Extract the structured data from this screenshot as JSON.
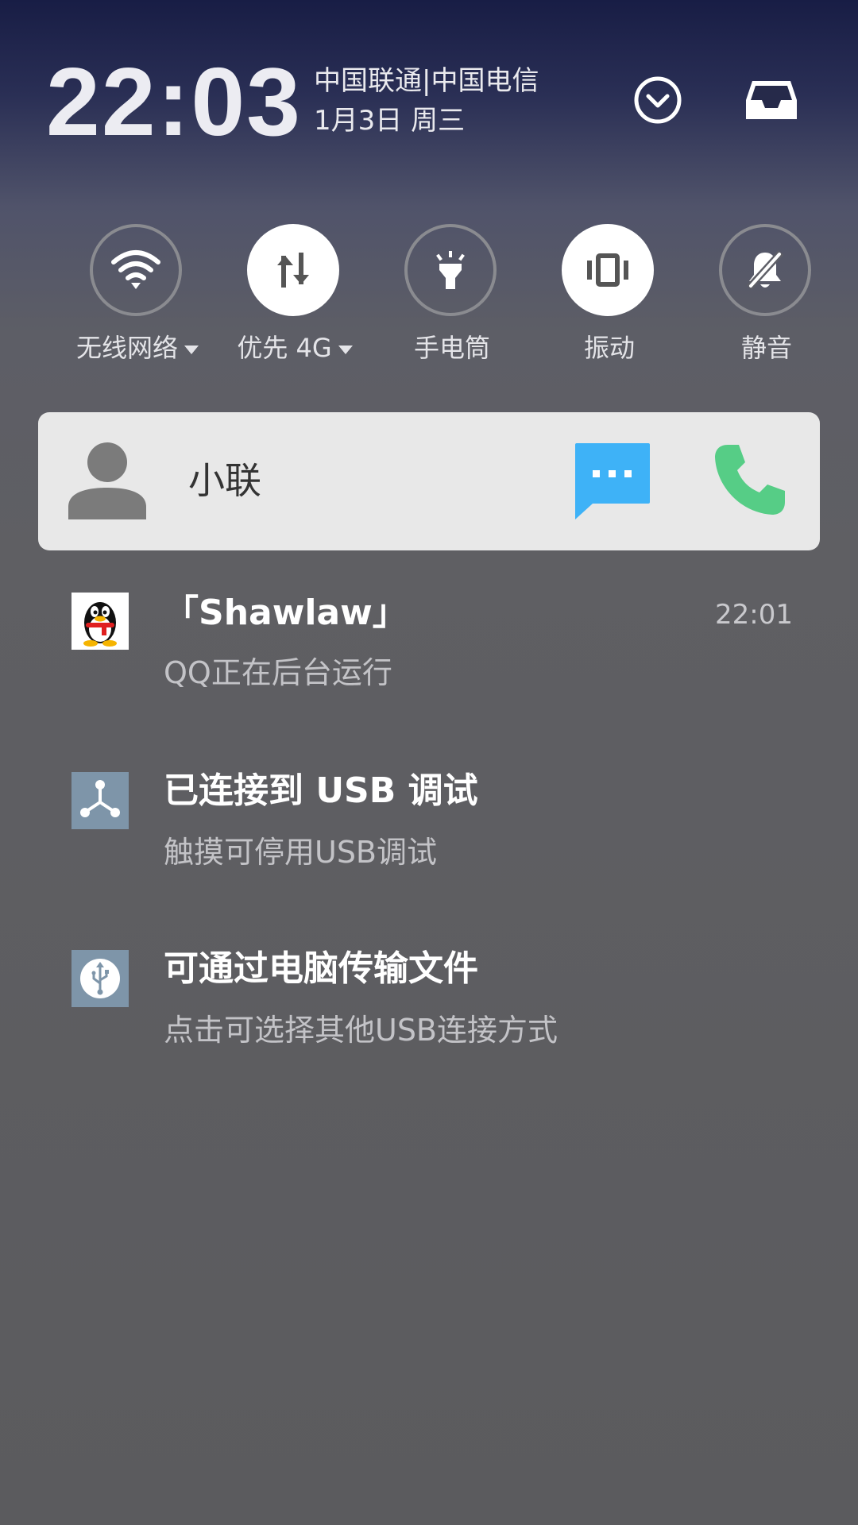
{
  "header": {
    "time": "22:03",
    "carrier": "中国联通|中国电信",
    "date": "1月3日 周三",
    "expand_icon": "chevron-down-circle-icon",
    "inbox_icon": "inbox-tray-icon"
  },
  "toggles": [
    {
      "label": "无线网络",
      "icon": "wifi-icon",
      "active": false,
      "has_dropdown": true
    },
    {
      "label": "优先 4G",
      "icon": "mobile-data-icon",
      "active": true,
      "has_dropdown": true
    },
    {
      "label": "手电筒",
      "icon": "flashlight-icon",
      "active": false,
      "has_dropdown": false
    },
    {
      "label": "振动",
      "icon": "vibrate-icon",
      "active": true,
      "has_dropdown": false
    },
    {
      "label": "静音",
      "icon": "bell-off-icon",
      "active": false,
      "has_dropdown": false
    }
  ],
  "contact_card": {
    "name": "小联",
    "message_icon": "message-bubble-icon",
    "call_icon": "phone-icon",
    "colors": {
      "message": "#3eb2f7",
      "call": "#56cd86"
    }
  },
  "notifications": [
    {
      "icon": "qq-penguin-icon",
      "title": "「Shawlaw」",
      "time": "22:01",
      "subtitle": "QQ正在后台运行"
    },
    {
      "icon": "usb-debug-icon",
      "title": "已连接到 USB 调试",
      "time": "",
      "subtitle": "触摸可停用USB调试"
    },
    {
      "icon": "usb-transfer-icon",
      "title": "可通过电脑传输文件",
      "time": "",
      "subtitle": "点击可选择其他USB连接方式"
    }
  ]
}
